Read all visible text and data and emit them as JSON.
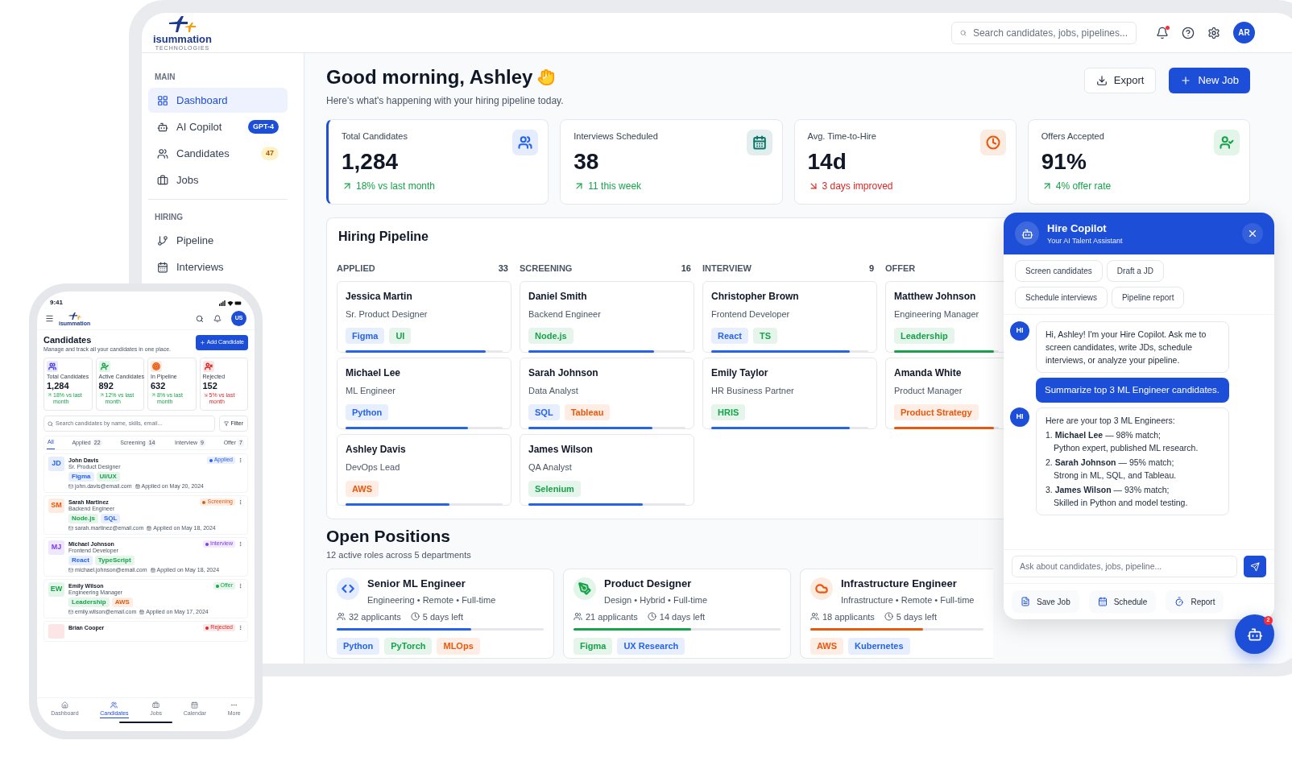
{
  "brand": {
    "name": "isummation",
    "tagline": "TECHNOLOGIES"
  },
  "header": {
    "search_placeholder": "Search candidates, jobs, pipelines...",
    "notification": true,
    "avatar": "AR"
  },
  "sidebar": {
    "sections": [
      {
        "title": "MAIN",
        "items": [
          {
            "label": "Dashboard",
            "selected": true
          },
          {
            "label": "AI Copilot",
            "selected": false,
            "badge": {
              "text": "GPT-4",
              "kind": "solid"
            }
          },
          {
            "label": "Candidates",
            "selected": false,
            "badge": {
              "text": "47",
              "kind": "soft"
            }
          },
          {
            "label": "Jobs",
            "selected": false
          }
        ]
      },
      {
        "title": "HIRING",
        "items": [
          {
            "label": "Pipeline",
            "selected": false
          },
          {
            "label": "Interviews",
            "selected": false
          }
        ]
      }
    ]
  },
  "greeting": {
    "title": "Good morning, Ashley",
    "subtitle": "Here's what's happening with your hiring pipeline today."
  },
  "actions": [
    {
      "label": "Export",
      "kind": "secondary"
    },
    {
      "label": "New Job",
      "kind": "primary"
    }
  ],
  "stats": [
    {
      "label": "Total Candidates",
      "value": "1,284",
      "trend": "18% vs last month",
      "kind": "rising",
      "color": "#2563eb",
      "selected": true
    },
    {
      "label": "Interviews Scheduled",
      "value": "38",
      "trend": "11 this week",
      "kind": "rising",
      "color": "#0f766e",
      "selected": false
    },
    {
      "label": "Avg. Time-to-Hire",
      "value": "14d",
      "trend": "3 days improved",
      "kind": "falling",
      "color": "#ea580c",
      "selected": false
    },
    {
      "label": "Offers Accepted",
      "value": "91%",
      "trend": "4% offer rate",
      "kind": "rising",
      "color": "#16a34a",
      "selected": false
    }
  ],
  "pipeline": {
    "title": "Hiring Pipeline",
    "columns": [
      {
        "name": "APPLIED",
        "count": "33",
        "cards": [
          {
            "name": "Jessica Martin",
            "role": "Sr. Product Designer",
            "tags": [
              {
                "label": "Figma",
                "color": "#2563eb"
              },
              {
                "label": "UI",
                "color": "#16a34a"
              }
            ],
            "level": 0.89,
            "color": "#2563eb"
          },
          {
            "name": "Michael Lee",
            "role": "ML Engineer",
            "tags": [
              {
                "label": "Python",
                "color": "#2563eb"
              }
            ],
            "level": 0.78,
            "color": "#2563eb"
          },
          {
            "name": "Ashley Davis",
            "role": "DevOps Lead",
            "tags": [
              {
                "label": "AWS",
                "color": "#ea580c"
              }
            ],
            "level": 0.66,
            "color": "#2563eb"
          }
        ]
      },
      {
        "name": "SCREENING",
        "count": "16",
        "cards": [
          {
            "name": "Daniel Smith",
            "role": "Backend Engineer",
            "tags": [
              {
                "label": "Node.js",
                "color": "#16a34a"
              }
            ],
            "level": 0.8,
            "color": "#2563eb"
          },
          {
            "name": "Sarah Johnson",
            "role": "Data Analyst",
            "tags": [
              {
                "label": "SQL",
                "color": "#2563eb"
              },
              {
                "label": "Tableau",
                "color": "#ea580c"
              }
            ],
            "level": 0.79,
            "color": "#2563eb"
          },
          {
            "name": "James Wilson",
            "role": "QA Analyst",
            "tags": [
              {
                "label": "Selenium",
                "color": "#16a34a"
              }
            ],
            "level": 0.73,
            "color": "#2563eb"
          }
        ]
      },
      {
        "name": "INTERVIEW",
        "count": "9",
        "cards": [
          {
            "name": "Christopher Brown",
            "role": "Frontend Developer",
            "tags": [
              {
                "label": "React",
                "color": "#2563eb"
              },
              {
                "label": "TS",
                "color": "#16a34a"
              }
            ],
            "level": 0.88,
            "color": "#2563eb"
          },
          {
            "name": "Emily Taylor",
            "role": "HR Business Partner",
            "tags": [
              {
                "label": "HRIS",
                "color": "#16a34a"
              }
            ],
            "level": 0.88,
            "color": "#2563eb"
          }
        ]
      },
      {
        "name": "OFFER",
        "cards": [
          {
            "name": "Matthew Johnson",
            "role": "Engineering Manager",
            "tags": [
              {
                "label": "Leadership",
                "color": "#16a34a"
              }
            ],
            "level": 0.95,
            "color": "#16a34a"
          },
          {
            "name": "Amanda White",
            "role": "Product Manager",
            "tags": [
              {
                "label": "Product Strategy",
                "color": "#ea580c"
              }
            ],
            "level": 0.95,
            "color": "#ea580c"
          }
        ]
      }
    ]
  },
  "open_positions": {
    "title": "Open Positions",
    "subtitle": "12 active roles across 5 departments",
    "jobs": [
      {
        "title": "Senior ML Engineer",
        "meta": "Engineering • Remote • Full-time",
        "applicants": "32 applicants",
        "deadline": "5 days left",
        "level": 0.65,
        "color": "#2563eb",
        "tags": [
          {
            "label": "Python",
            "color": "#2563eb"
          },
          {
            "label": "PyTorch",
            "color": "#16a34a"
          },
          {
            "label": "MLOps",
            "color": "#ea580c"
          }
        ]
      },
      {
        "title": "Product Designer",
        "meta": "Design • Hybrid • Full-time",
        "applicants": "21 applicants",
        "deadline": "14 days left",
        "level": 0.57,
        "color": "#16a34a",
        "tags": [
          {
            "label": "Figma",
            "color": "#16a34a"
          },
          {
            "label": "UX Research",
            "color": "#2563eb"
          }
        ]
      },
      {
        "title": "Infrastructure Engineer",
        "meta": "Infrastructure • Remote • Full-time",
        "applicants": "18 applicants",
        "deadline": "5 days left",
        "level": 0.65,
        "color": "#ea580c",
        "tags": [
          {
            "label": "AWS",
            "color": "#ea580c"
          },
          {
            "label": "Kubernetes",
            "color": "#2563eb"
          }
        ]
      }
    ]
  },
  "copilot": {
    "title": "Hire Copilot",
    "subtitle": "Your AI Talent Assistant",
    "chips": [
      "Screen candidates",
      "Draft a JD",
      "Schedule interviews",
      "Pipeline report"
    ],
    "messages": [
      {
        "kind": "bot",
        "avatar": "HI",
        "text": "Hi, Ashley! I'm your Hire Copilot. Ask me to screen candidates, write JDs, schedule interviews, or analyze your pipeline."
      },
      {
        "kind": "user",
        "text": "Summarize top 3 ML Engineer candidates."
      },
      {
        "kind": "bot",
        "avatar": "HI",
        "text": "Here are your top 3 ML Engineers:",
        "list": [
          {
            "line": "1. **Michael Lee** — 98% match;",
            "note": "Python expert, published ML research."
          },
          {
            "line": "2. **Sarah Johnson** — 95% match;",
            "note": "Strong in ML, SQL, and Tableau."
          },
          {
            "line": "3. **James Wilson** — 93% match;",
            "note": "Skilled in Python and model testing."
          }
        ]
      }
    ],
    "input_placeholder": "Ask about candidates, jobs, pipeline...",
    "actions": [
      "Save Job",
      "Schedule",
      "Report"
    ],
    "fab_badge": "2"
  },
  "phone": {
    "time": "9:41",
    "logo_text": "isummation",
    "avatar": "US",
    "title": "Candidates",
    "subtitle": "Manage and track all your candidates in one place.",
    "add_button": "Add Candidate",
    "stats": [
      {
        "label": "Total Candidates",
        "value": "1,284",
        "trend": "18% vs last month",
        "kind": "rising",
        "color": "#4f46e5"
      },
      {
        "label": "Active Candidates",
        "value": "892",
        "trend": "12% vs last month",
        "kind": "rising",
        "color": "#16a34a"
      },
      {
        "label": "In Pipeline",
        "value": "632",
        "trend": "8% vs last month",
        "kind": "rising",
        "color": "#ea580c"
      },
      {
        "label": "Rejected",
        "value": "152",
        "trend": "5% vs last month",
        "kind": "falling",
        "color": "#dc2626"
      }
    ],
    "search_placeholder": "Search candidates by name, skills, email...",
    "filter": "Filter",
    "tabs": [
      {
        "label": "All",
        "selected": true
      },
      {
        "label": "Applied",
        "count": "22",
        "selected": false
      },
      {
        "label": "Screening",
        "count": "14",
        "selected": false
      },
      {
        "label": "Interview",
        "count": "9",
        "selected": false
      },
      {
        "label": "Offer",
        "count": "7",
        "selected": false
      }
    ],
    "candidates": [
      {
        "initials": "JD",
        "name": "John Davis",
        "role": "Sr. Product Designer",
        "status": "Applied",
        "color": "#2563eb",
        "tags": [
          {
            "label": "Figma",
            "color": "#2563eb"
          },
          {
            "label": "UI/UX",
            "color": "#16a34a"
          }
        ],
        "email": "john.davis@email.com",
        "applied": "Applied on May 20, 2024"
      },
      {
        "initials": "SM",
        "name": "Sarah Martinez",
        "role": "Backend Engineer",
        "status": "Screening",
        "color": "#ea580c",
        "tags": [
          {
            "label": "Node.js",
            "color": "#16a34a"
          },
          {
            "label": "SQL",
            "color": "#2563eb"
          }
        ],
        "email": "sarah.martinez@email.com",
        "applied": "Applied on May 18, 2024"
      },
      {
        "initials": "MJ",
        "name": "Michael Johnson",
        "role": "Frontend Developer",
        "status": "Interview",
        "color": "#7c3aed",
        "tags": [
          {
            "label": "React",
            "color": "#2563eb"
          },
          {
            "label": "TypeScript",
            "color": "#16a34a"
          }
        ],
        "email": "michael.johnson@email.com",
        "applied": "Applied on May 18, 2024"
      },
      {
        "initials": "EW",
        "name": "Emily Wilson",
        "role": "Engineering Manager",
        "status": "Offer",
        "color": "#16a34a",
        "tags": [
          {
            "label": "Leadership",
            "color": "#16a34a"
          },
          {
            "label": "AWS",
            "color": "#ea580c"
          }
        ],
        "email": "emily.wilson@email.com",
        "applied": "Applied on May 17, 2024"
      },
      {
        "name": "Brian Cooper",
        "status": "Rejected",
        "color": "#dc2626"
      }
    ],
    "nav": [
      {
        "label": "Dashboard",
        "selected": false
      },
      {
        "label": "Candidates",
        "selected": true
      },
      {
        "label": "Jobs",
        "selected": false
      },
      {
        "label": "Calendar",
        "selected": false
      },
      {
        "label": "More",
        "selected": false
      }
    ]
  }
}
